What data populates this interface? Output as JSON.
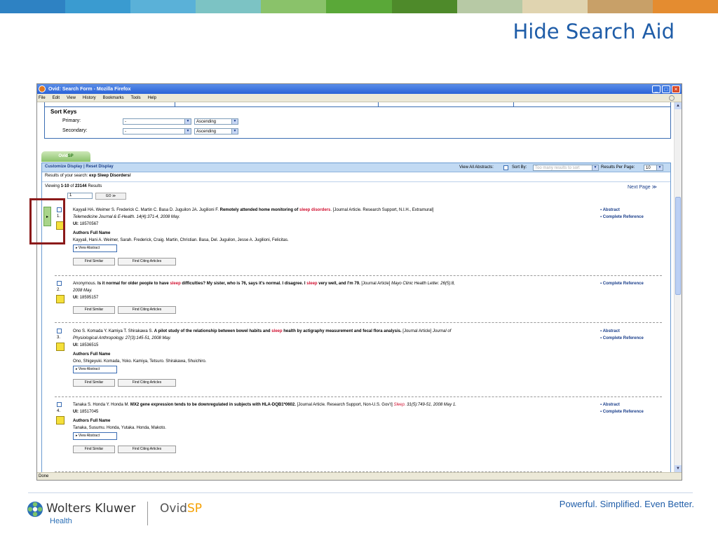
{
  "slide": {
    "title": "Hide Search Aid",
    "banner_colors": [
      "#2e82c3",
      "#3a9bd0",
      "#5ab1d8",
      "#7cc3c4",
      "#8ac26a",
      "#5aa838",
      "#4e8a2a",
      "#b7c9a5",
      "#e0d4b0",
      "#c8a068",
      "#e48c30"
    ],
    "footer": {
      "company": "Wolters Kluwer",
      "company_sub": "Health",
      "product_prefix": "Ovid",
      "product_suffix": "SP",
      "tagline": "Powerful. Simplified. Even Better."
    }
  },
  "browser": {
    "title": "Ovid: Search Form - Mozilla Firefox",
    "menu": [
      "File",
      "Edit",
      "View",
      "History",
      "Bookmarks",
      "Tools",
      "Help"
    ],
    "window_buttons": [
      "_",
      "□",
      "×"
    ],
    "status": "Done"
  },
  "sort": {
    "heading": "Sort Keys",
    "primary_label": "Primary:",
    "secondary_label": "Secondary:",
    "primary_value": "-",
    "secondary_value": "-",
    "order_value": "Ascending"
  },
  "results": {
    "tab_prefix": "Ovid",
    "tab_suffix": "SP",
    "customize": "Customize Display",
    "divider": "|",
    "reset": "Reset Display",
    "view_all_abstracts": "View All Abstracts:",
    "sort_by_label": "Sort By:",
    "sort_by_value": "Too many results to sort",
    "per_page_label": "Results Per Page:",
    "per_page_value": "10",
    "search_label": "Results of your search:",
    "search_query": "exp Sleep Disorders/",
    "viewing_prefix": "Viewing",
    "viewing_range": "1-10",
    "viewing_of": "of",
    "viewing_total": "23144",
    "viewing_suffix": "Results",
    "next_page": "Next Page ≫",
    "goto_value": "1",
    "go_label": "GO ≫",
    "handle_arrow": "▸",
    "labels": {
      "authors_full_name": "Authors Full Name",
      "view_abstract": "▸ View Abstract",
      "find_similar": "Find Similar",
      "find_citing": "Find Citing Articles",
      "ui": "UI:",
      "abstract": "▪ Abstract",
      "complete_reference": "▪ Complete Reference"
    },
    "records": [
      {
        "num": "1.",
        "a": "Kayyali HA. Weimer S. Frederick C. Martin C. Basa D. Juguilon JA. Jugilioni F.",
        "b": "Remotely attended home monitoring of",
        "hl": "sleep disorders",
        "c": ". [Journal Article. Research Support, N.I.H., Extramural]",
        "journal": "Telemedicine Journal & E-Health. 14(4):371-4, 2008 May.",
        "ui": "18570567",
        "authors_full": "Kayyali, Hani A. Weimer, Sarah. Frederick, Craig. Martin, Christian. Basa, Del. Juguilon, Jesse A. Jugilioni, Felicitas."
      },
      {
        "num": "2.",
        "a": "Anonymous.",
        "b": "Is it normal for older people to have",
        "hl": "sleep",
        "c": "difficulties? My sister, who is 76, says it's normal. I disagree. I",
        "hl2": "sleep",
        "d": "very well, and I'm 79.",
        "e": "[Journal Article]",
        "journal": "Mayo Clinic Health Letter. 26(5):8,",
        "journal2": "2008 May.",
        "ui": "18595157"
      },
      {
        "num": "3.",
        "a": "Ono S. Komada Y. Kamiya T. Shirakawa S.",
        "b": "A pilot study of the relationship between bowel habits and",
        "hl": "sleep",
        "c": "health by actigraphy measurement and fecal flora analysis.",
        "e": "[Journal Article]",
        "journal": "Journal of",
        "journal2": "Physiological Anthropology. 27(3):145-51, 2008 May.",
        "ui": "18536515",
        "authors_full": "Ono, Shigeyuki. Komada, Yoko. Kamiya, Tetsuro. Shirakawa, Shuichiro."
      },
      {
        "num": "4.",
        "a": "Tanaka S. Honda Y. Honda M.",
        "b": "MX2 gene expression tends to be downregulated in subjects with HLA-DQB1*0602.",
        "e": "[Journal Article. Research Support, Non-U.S. Gov't]",
        "hl": "Sleep.",
        "journal": "31(5):749-51, 2008 May 1.",
        "ui": "18517045",
        "authors_full": "Tanaka, Susumu. Honda, Yutaka. Honda, Makoto."
      }
    ]
  }
}
